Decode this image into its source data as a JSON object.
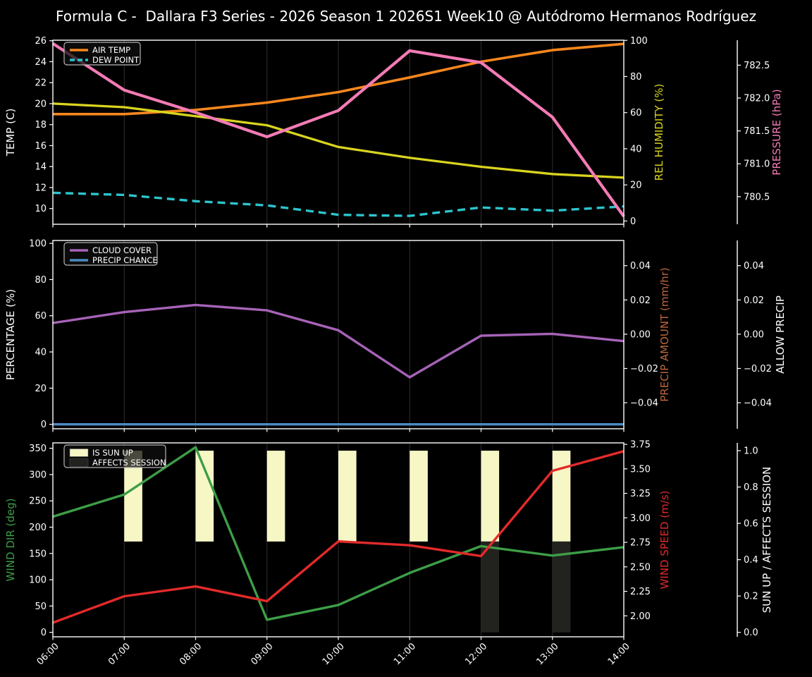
{
  "title": "Formula C -  Dallara F3 Series - 2026 Season 1 2026S1 Week10 @ Autódromo Hermanos Rodríguez",
  "colors": {
    "background": "#000000",
    "text": "#ffffff",
    "grid": "#2a2a2a",
    "spine": "#ffffff",
    "air_temp": "#f7871e",
    "dew_point": "#2dc4cc",
    "rel_humidity": "#d9d41f",
    "pressure": "#f37bb5",
    "cloud_cover": "#a763b8",
    "precip_chance": "#4a8ac2",
    "precip_amount": "#bc663b",
    "allow_precip": "#ffffff",
    "wind_dir": "#3d9e47",
    "wind_speed": "#e32a2a",
    "sun_up_bar": "#f7f7c6",
    "affects_bar": "#22221f",
    "legend_border": "#b5b5b5"
  },
  "chart_data": [
    {
      "id": "temperature",
      "type": "line",
      "categories": [
        "06:00",
        "07:00",
        "08:00",
        "09:00",
        "10:00",
        "11:00",
        "12:00",
        "13:00",
        "14:00"
      ],
      "grid": "vertical-only",
      "axes": {
        "left": {
          "label": "TEMP (C)",
          "color": "#ffffff",
          "ticks": [
            10,
            12,
            14,
            16,
            18,
            20,
            22,
            24,
            26
          ],
          "lim": [
            8.5,
            26.05
          ],
          "decimals": 0
        },
        "right": {
          "label": "REL HUMIDITY (%)",
          "color": "#d9d41f",
          "ticks": [
            0,
            20,
            40,
            60,
            80,
            100
          ],
          "lim": [
            -1.8,
            100.1
          ],
          "decimals": 0
        },
        "offset": {
          "label": "PRESSURE (hPa)",
          "color": "#f37bb5",
          "ticks": [
            780.5,
            781.0,
            781.5,
            782.0,
            782.5
          ],
          "lim": [
            780.08,
            782.88
          ],
          "decimals": 1
        }
      },
      "series": [
        {
          "name": "AIR TEMP",
          "axis": "left",
          "color": "#f7871e",
          "dashed": false,
          "width": 3.6,
          "values": [
            19.0,
            19.0,
            19.4,
            20.1,
            21.1,
            22.5,
            24.0,
            25.1,
            25.7
          ]
        },
        {
          "name": "DEW POINT",
          "axis": "left",
          "color": "#2dc4cc",
          "dashed": true,
          "width": 3.4,
          "values": [
            11.5,
            11.3,
            10.7,
            10.3,
            9.4,
            9.3,
            10.1,
            9.8,
            10.2
          ]
        },
        {
          "name": "REL HUMIDITY",
          "axis": "right",
          "color": "#d9d41f",
          "dashed": false,
          "width": 3.3,
          "values": [
            65,
            63,
            58,
            53,
            41,
            35,
            30,
            26,
            24
          ]
        },
        {
          "name": "PRESSURE",
          "axis": "offset",
          "color": "#f37bb5",
          "dashed": false,
          "width": 4.2,
          "values": [
            782.83,
            782.12,
            781.78,
            781.41,
            781.81,
            782.72,
            782.54,
            781.71,
            780.2
          ]
        }
      ],
      "legend": {
        "position": "upper-left",
        "items": [
          {
            "label": "AIR TEMP",
            "type": "line",
            "color": "#f7871e",
            "dashed": false
          },
          {
            "label": "DEW POINT",
            "type": "line",
            "color": "#2dc4cc",
            "dashed": true
          }
        ]
      }
    },
    {
      "id": "precipitation",
      "type": "line",
      "categories": [
        "06:00",
        "07:00",
        "08:00",
        "09:00",
        "10:00",
        "11:00",
        "12:00",
        "13:00",
        "14:00"
      ],
      "grid": "vertical-only",
      "axes": {
        "left": {
          "label": "PERCENTAGE (%)",
          "color": "#ffffff",
          "ticks": [
            0,
            20,
            40,
            60,
            80,
            100
          ],
          "lim": [
            -2.45,
            101.6
          ],
          "decimals": 0
        },
        "right": {
          "label": "PRECIP AMOUNT (mm/hr)",
          "color": "#bc663b",
          "ticks": [
            -0.04,
            -0.02,
            0.0,
            0.02,
            0.04
          ],
          "lim": [
            -0.0552,
            0.0547
          ],
          "decimals": 2
        },
        "offset": {
          "label": "ALLOW PRECIP",
          "color": "#ffffff",
          "ticks": [
            -0.04,
            -0.02,
            0.0,
            0.02,
            0.04
          ],
          "lim": [
            -0.0552,
            0.0547
          ],
          "decimals": 2
        }
      },
      "series": [
        {
          "name": "CLOUD COVER",
          "axis": "left",
          "color": "#a763b8",
          "dashed": false,
          "width": 3.4,
          "values": [
            56,
            62,
            66,
            63,
            52,
            26,
            49,
            50,
            46
          ]
        },
        {
          "name": "PRECIP CHANCE",
          "axis": "left",
          "color": "#4a8ac2",
          "dashed": false,
          "width": 3.4,
          "values": [
            0,
            0,
            0,
            0,
            0,
            0,
            0,
            0,
            0
          ]
        }
      ],
      "legend": {
        "position": "upper-left",
        "items": [
          {
            "label": "CLOUD COVER",
            "type": "line",
            "color": "#a763b8",
            "dashed": false
          },
          {
            "label": "PRECIP CHANCE",
            "type": "line",
            "color": "#4a8ac2",
            "dashed": false
          }
        ]
      }
    },
    {
      "id": "wind",
      "type": "line+bar",
      "categories": [
        "06:00",
        "07:00",
        "08:00",
        "09:00",
        "10:00",
        "11:00",
        "12:00",
        "13:00",
        "14:00"
      ],
      "grid": "vertical-only",
      "x_tick_labels_shown": true,
      "axes": {
        "left": {
          "label": "WIND DIR (deg)",
          "color": "#3d9e47",
          "ticks": [
            0,
            50,
            100,
            150,
            200,
            250,
            300,
            350
          ],
          "lim": [
            -8.5,
            360.3
          ],
          "decimals": 0
        },
        "right": {
          "label": "WIND SPEED (m/s)",
          "color": "#e32a2a",
          "ticks": [
            2.0,
            2.25,
            2.5,
            2.75,
            3.0,
            3.25,
            3.5,
            3.75
          ],
          "lim": [
            1.786,
            3.765
          ],
          "decimals": 2
        },
        "offset": {
          "label": "SUN UP / AFFECTS SESSION",
          "color": "#ffffff",
          "ticks": [
            0.0,
            0.2,
            0.4,
            0.6,
            0.8,
            1.0
          ],
          "lim": [
            -0.0245,
            1.043
          ],
          "decimals": 1
        }
      },
      "bars": [
        {
          "name": "IS SUN UP",
          "axis": "offset",
          "color": "#f7f7c6",
          "from": 0.5,
          "to": 1.0,
          "hours": [
            "07:00",
            "08:00",
            "09:00",
            "10:00",
            "11:00",
            "12:00",
            "13:00"
          ],
          "bar_width_hours": 0.253
        },
        {
          "name": "AFFECTS SESSION",
          "axis": "offset",
          "color": "#22221f",
          "from": 0.0,
          "to": 0.5,
          "hours": [
            "12:00",
            "13:00"
          ],
          "bar_width_hours": 0.253
        }
      ],
      "series": [
        {
          "name": "WIND DIR",
          "axis": "left",
          "color": "#3d9e47",
          "dashed": false,
          "width": 3.4,
          "values": [
            220,
            262,
            352,
            24,
            52,
            113,
            164,
            146,
            162
          ]
        },
        {
          "name": "WIND SPEED",
          "axis": "right",
          "color": "#e32a2a",
          "dashed": false,
          "width": 3.4,
          "values": [
            1.93,
            2.2,
            2.3,
            2.15,
            2.76,
            2.72,
            2.61,
            3.48,
            3.68
          ]
        }
      ],
      "legend": {
        "position": "upper-left",
        "items": [
          {
            "label": "IS SUN UP",
            "type": "patch",
            "color": "#f7f7c6"
          },
          {
            "label": "AFFECTS SESSION",
            "type": "patch",
            "color": "#22221f"
          }
        ]
      }
    }
  ]
}
